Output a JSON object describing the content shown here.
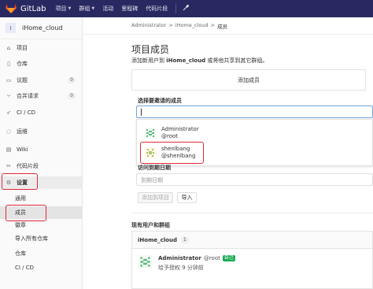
{
  "navbar": {
    "brand": "GitLab",
    "items": [
      {
        "label": "项目",
        "caret": "▼"
      },
      {
        "label": "群组",
        "caret": "▼"
      },
      {
        "label": "活动"
      },
      {
        "label": "里程碑"
      },
      {
        "label": "代码片段"
      }
    ],
    "brand_color": "#292961"
  },
  "sidebar": {
    "project_avatar_letter": "I",
    "project_name": "iHome_cloud",
    "items": [
      {
        "label": "项目",
        "icon": "home-icon"
      },
      {
        "label": "仓库",
        "icon": "book-icon"
      },
      {
        "label": "议题",
        "icon": "issues-icon",
        "count": "0"
      },
      {
        "label": "合并请求",
        "icon": "merge-request-icon",
        "count": "0"
      },
      {
        "label": "CI / CD",
        "icon": "rocket-icon"
      },
      {
        "label": "运维",
        "icon": "operations-icon"
      },
      {
        "label": "Wiki",
        "icon": "wiki-icon"
      },
      {
        "label": "代码片段",
        "icon": "snippet-icon"
      },
      {
        "label": "设置",
        "icon": "gear-icon"
      }
    ],
    "sub_items": [
      {
        "label": "通用"
      },
      {
        "label": "成员"
      },
      {
        "label": "徽章"
      },
      {
        "label": "导入所有仓库"
      },
      {
        "label": "仓库"
      },
      {
        "label": "CI / CD"
      }
    ]
  },
  "breadcrumb": {
    "items": [
      "Administrator",
      ">",
      "iHome_cloud",
      ">",
      "成员"
    ]
  },
  "main": {
    "title": "项目成员",
    "desc_prefix": "添加新用户到 ",
    "desc_project": "iHome_cloud",
    "desc_suffix": " 或将他共享到其它群组。",
    "tab_label": "添加成员",
    "invite_label": "选择要邀请的成员",
    "invite_value": "",
    "dropdown": [
      {
        "name": "Administrator",
        "username": "@root"
      },
      {
        "name": "shenlbang",
        "username": "@shenlbang"
      }
    ],
    "access_label": "访问到期日期",
    "date_placeholder": "到期日期",
    "add_button": "添加到项目",
    "import_button": "导入",
    "existing_title": "现有用户和群组",
    "group_name": "iHome_cloud",
    "group_count": "1",
    "member": {
      "name": "Administrator",
      "username": "@root",
      "badge": "自己",
      "granted": "给予授权 9 分钟前"
    }
  },
  "colors": {
    "highlight_box": "#e0283a",
    "self_badge": "#1aaa55",
    "input_focus": "#74a7de"
  }
}
